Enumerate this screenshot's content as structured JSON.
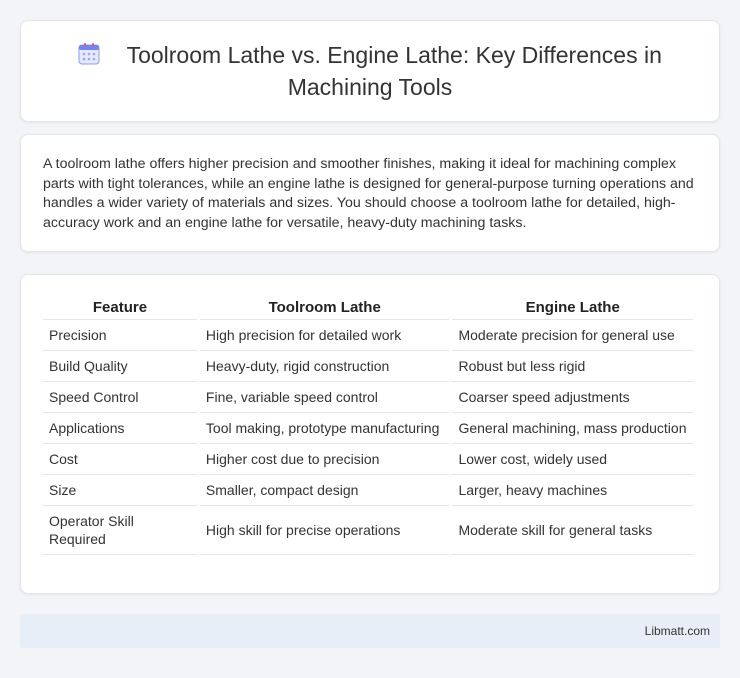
{
  "header": {
    "title": "Toolroom Lathe vs. Engine Lathe: Key Differences in Machining Tools",
    "icon": "calendar-icon"
  },
  "intro": {
    "text": "A toolroom lathe offers higher precision and smoother finishes, making it ideal for machining complex parts with tight tolerances, while an engine lathe is designed for general-purpose turning operations and handles a wider variety of materials and sizes. You should choose a toolroom lathe for detailed, high-accuracy work and an engine lathe for versatile, heavy-duty machining tasks."
  },
  "table": {
    "headers": [
      "Feature",
      "Toolroom Lathe",
      "Engine Lathe"
    ],
    "rows": [
      [
        "Precision",
        "High precision for detailed work",
        "Moderate precision for general use"
      ],
      [
        "Build Quality",
        "Heavy-duty, rigid construction",
        "Robust but less rigid"
      ],
      [
        "Speed Control",
        "Fine, variable speed control",
        "Coarser speed adjustments"
      ],
      [
        "Applications",
        "Tool making, prototype manufacturing",
        "General machining, mass production"
      ],
      [
        "Cost",
        "Higher cost due to precision",
        "Lower cost, widely used"
      ],
      [
        "Size",
        "Smaller, compact design",
        "Larger, heavy machines"
      ],
      [
        "Operator Skill Required",
        "High skill for precise operations",
        "Moderate skill for general tasks"
      ]
    ]
  },
  "footer": {
    "brand": "Libmatt.com"
  }
}
